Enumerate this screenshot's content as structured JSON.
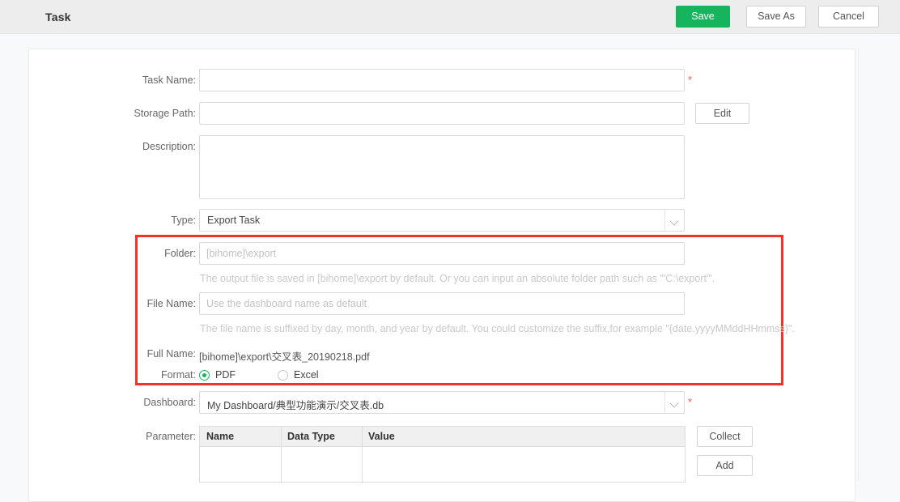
{
  "header": {
    "title": "Task",
    "save_label": "Save",
    "save_as_label": "Save As",
    "cancel_label": "Cancel",
    "accent_color": "#16b45d"
  },
  "form": {
    "task_name": {
      "label": "Task Name:",
      "value": "",
      "placeholder": "",
      "required_marker": "*"
    },
    "storage_path": {
      "label": "Storage Path:",
      "value": "",
      "placeholder": "",
      "edit_label": "Edit"
    },
    "description": {
      "label": "Description:",
      "value": "",
      "placeholder": ""
    },
    "type": {
      "label": "Type:",
      "value": "Export Task"
    },
    "folder": {
      "label": "Folder:",
      "value": "",
      "placeholder": "[bihome]\\export",
      "hint": "The output file is saved in [bihome]\\export by default. Or you can input an absolute folder path such as \"'C:\\export'\"."
    },
    "file_name": {
      "label": "File Name:",
      "value": "",
      "placeholder": "Use the dashboard name as default",
      "hint": "The file name is suffixed by day, month, and year by default. You could customize the suffix,for example \"{date.yyyyMMddHHmmss}\"."
    },
    "full_name": {
      "label": "Full Name:",
      "value": "[bihome]\\export\\交叉表_20190218.pdf"
    },
    "format": {
      "label": "Format:",
      "selected": "PDF",
      "options": [
        "PDF",
        "Excel"
      ]
    },
    "dashboard": {
      "label": "Dashboard:",
      "value": "My Dashboard/典型功能演示/交叉表.db",
      "required_marker": "*"
    },
    "parameter": {
      "label": "Parameter:",
      "columns": [
        "Name",
        "Data Type",
        "Value"
      ],
      "rows": [],
      "collect_label": "Collect",
      "add_label": "Add"
    }
  },
  "highlight": {
    "color": "#f4322c"
  }
}
